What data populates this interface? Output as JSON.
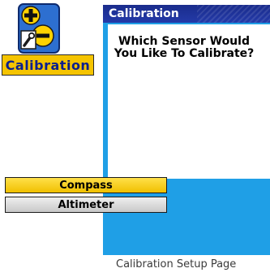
{
  "app_icon": {
    "label": "Calibration",
    "icon": "calibration-plus-minus-wrench-icon",
    "colors": {
      "label_background": "#f5c400",
      "label_text": "#0a1f8f"
    }
  },
  "window": {
    "title": "Calibration",
    "prompt": "Which Sensor Would You Like To Calibrate?",
    "options": [
      {
        "label": "Compass",
        "selected": true
      },
      {
        "label": "Altimeter",
        "selected": false
      }
    ],
    "colors": {
      "title_bar": "#1a2c8c",
      "screen": "#1f9fe6",
      "highlight": "#f5c400"
    }
  },
  "caption": "Calibration Setup Page"
}
